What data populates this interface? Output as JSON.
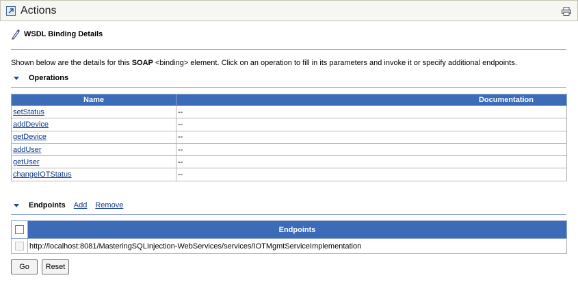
{
  "header": {
    "title": "Actions",
    "icon": "external-link-icon",
    "print_icon": "print-icon"
  },
  "wsdl": {
    "heading": "WSDL Binding Details",
    "icon": "wsdl-binding-icon",
    "desc_prefix": "Shown below are the details for this ",
    "desc_bold": "SOAP",
    "desc_suffix": " <binding> element. Click on an operation to fill in its parameters and invoke it or specify additional endpoints."
  },
  "operations": {
    "title": "Operations",
    "columns": [
      "Name",
      "Documentation"
    ],
    "rows": [
      {
        "name": "setStatus",
        "doc": "--"
      },
      {
        "name": "addDevice",
        "doc": "--"
      },
      {
        "name": "getDevice",
        "doc": "--"
      },
      {
        "name": "addUser",
        "doc": "--"
      },
      {
        "name": "getUser",
        "doc": "--"
      },
      {
        "name": "changeIOTStatus",
        "doc": "--"
      }
    ]
  },
  "endpoints": {
    "title": "Endpoints",
    "add_label": "Add",
    "remove_label": "Remove",
    "column": "Endpoints",
    "rows": [
      {
        "url": "http://localhost:8081/MasteringSQLInjection-WebServices/services/IOTMgmtServiceImplementation"
      }
    ]
  },
  "buttons": {
    "go": "Go",
    "reset": "Reset"
  },
  "colors": {
    "header_blue": "#3c6cb7",
    "link": "#0a3a8c",
    "rule": "#8aa2cf"
  }
}
